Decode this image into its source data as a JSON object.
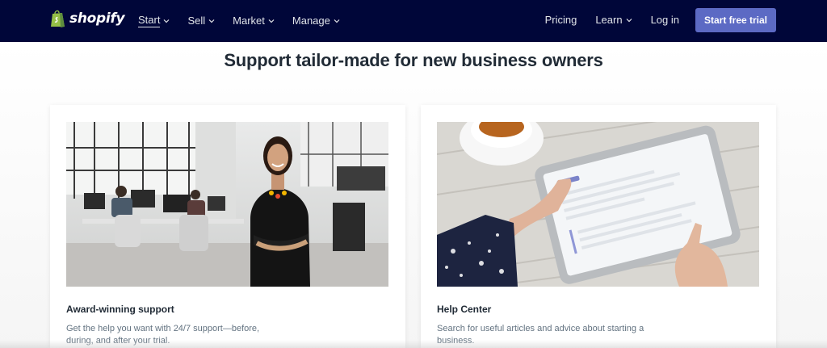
{
  "nav": {
    "logo_text": "shopify",
    "left_links": [
      {
        "label": "Start",
        "has_chevron": true,
        "active": true
      },
      {
        "label": "Sell",
        "has_chevron": true
      },
      {
        "label": "Market",
        "has_chevron": true
      },
      {
        "label": "Manage",
        "has_chevron": true
      }
    ],
    "right_links": [
      {
        "label": "Pricing",
        "has_chevron": false
      },
      {
        "label": "Learn",
        "has_chevron": true
      },
      {
        "label": "Log in",
        "has_chevron": false
      }
    ],
    "cta_label": "Start free trial"
  },
  "main": {
    "headline": "Support tailor-made for new business owners",
    "cards": [
      {
        "image": "office-woman-smiling-photo",
        "title": "Award-winning support",
        "description": "Get the help you want with 24/7 support—before, during, and after your trial."
      },
      {
        "image": "hand-holding-tablet-photo",
        "title": "Help Center",
        "description": "Search for useful articles and advice about starting a business."
      }
    ]
  },
  "colors": {
    "nav_bg": "#000639",
    "cta_bg": "#5c6ac4",
    "heading": "#212b36",
    "body_text": "#637381"
  }
}
